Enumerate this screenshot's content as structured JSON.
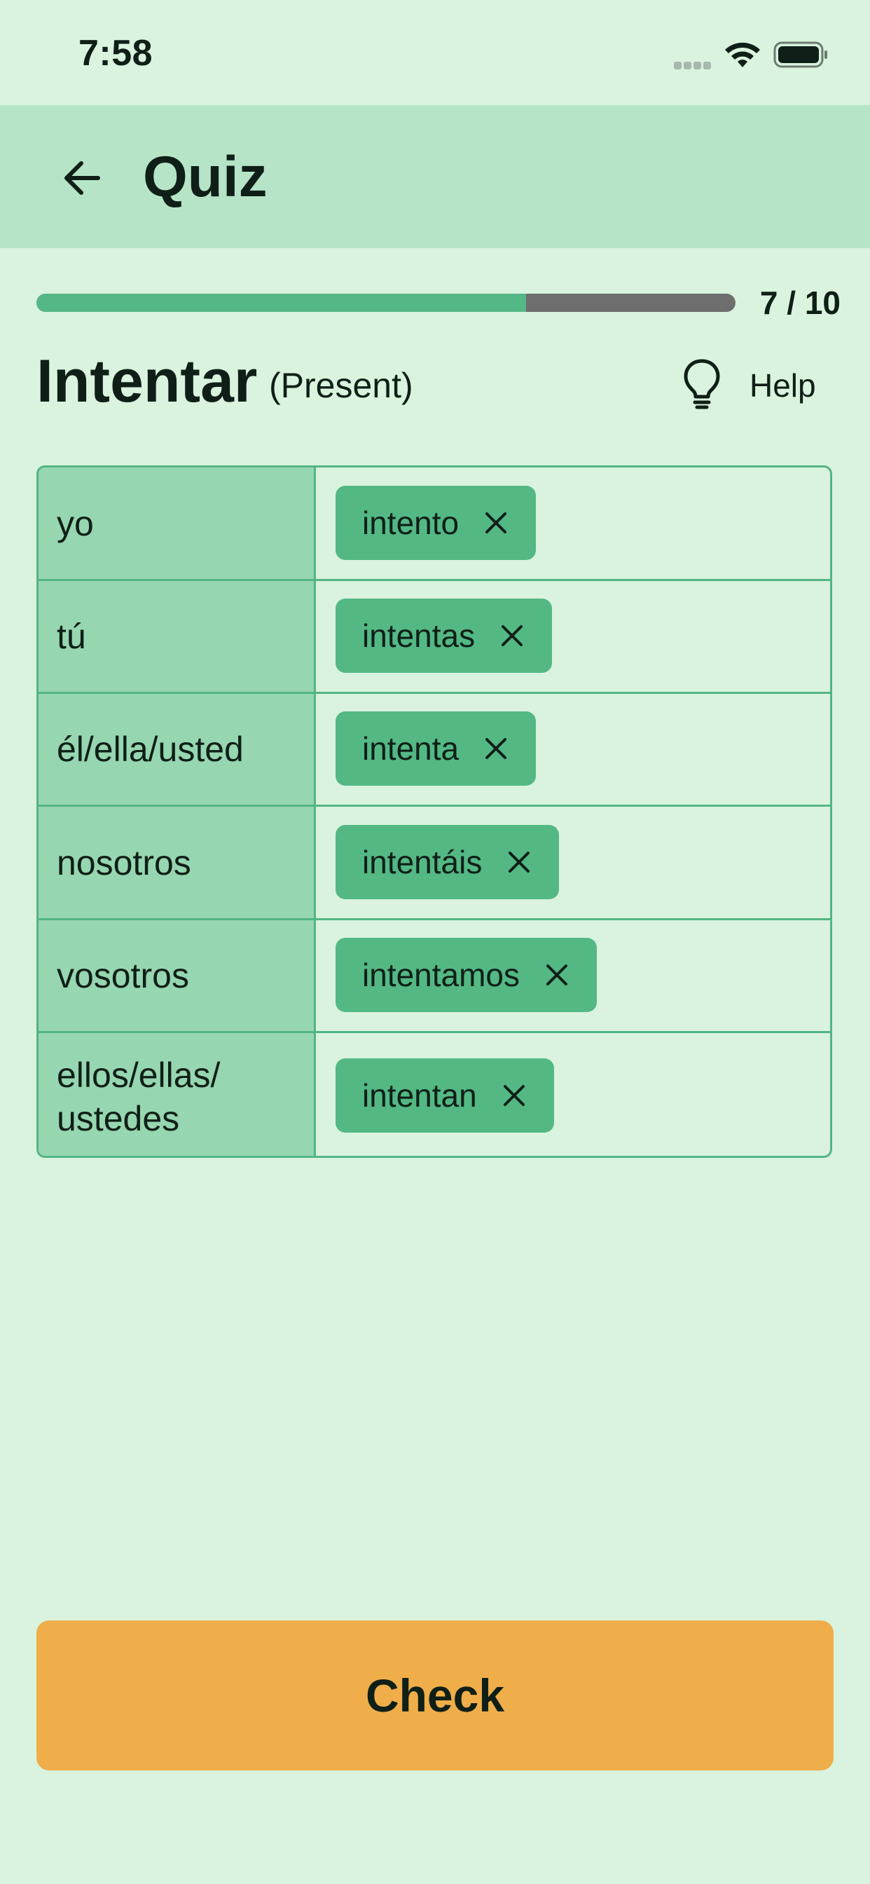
{
  "status_bar": {
    "time": "7:58"
  },
  "app_bar": {
    "title": "Quiz"
  },
  "progress": {
    "current": 7,
    "total": 10,
    "label": "7 / 10",
    "fraction": 0.7
  },
  "verb": {
    "infinitive": "Intentar",
    "tense": "(Present)"
  },
  "help": {
    "label": "Help"
  },
  "conjugations": [
    {
      "pronoun": "yo",
      "answer": "intento"
    },
    {
      "pronoun": "tú",
      "answer": "intentas"
    },
    {
      "pronoun": "él/ella/usted",
      "answer": "intenta"
    },
    {
      "pronoun": "nosotros",
      "answer": "intentáis"
    },
    {
      "pronoun": "vosotros",
      "answer": "intentamos"
    },
    {
      "pronoun": "ellos/ellas/ ustedes",
      "answer": "intentan"
    }
  ],
  "actions": {
    "check_label": "Check"
  },
  "colors": {
    "background": "#d9f3de",
    "app_bar": "#b6e4c7",
    "accent": "#54b886",
    "pronoun_cell": "#96d6b0",
    "check_button": "#efae4a",
    "progress_remaining": "#6d6e6d"
  },
  "icons": {
    "back": "arrow-left-icon",
    "help": "lightbulb-icon",
    "remove": "close-icon",
    "wifi": "wifi-icon",
    "battery": "battery-icon"
  }
}
